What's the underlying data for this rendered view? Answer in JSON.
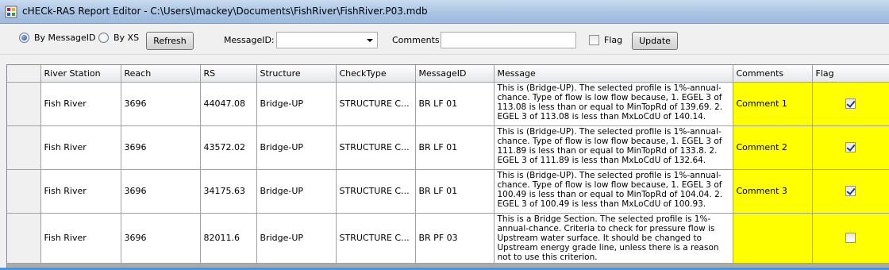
{
  "window": {
    "title": "cHECk-RAS Report Editor - C:\\Users\\lmackey\\Documents\\FishRiver\\FishRiver.P03.mdb"
  },
  "toolbar": {
    "by_messageid_label": "By MessageID",
    "by_xs_label": "By XS",
    "selected_mode": "By MessageID",
    "refresh_label": "Refresh",
    "messageid_label": "MessageID:",
    "messageid_value": "",
    "comments_label": "Comments:",
    "comments_value": "",
    "flag_label": "Flag",
    "flag_checked": false,
    "update_label": "Update"
  },
  "grid": {
    "columns": [
      "River Station",
      "Reach",
      "RS",
      "Structure",
      "CheckType",
      "MessageID",
      "Message",
      "Comments",
      "Flag"
    ],
    "rows": [
      {
        "river": "Fish River",
        "reach": "3696",
        "rs": "44047.08",
        "structure": "Bridge-UP",
        "checktype": "STRUCTURE C...",
        "messageid": "BR LF 01",
        "message": "This is (Bridge-UP). The selected profile is 1%-annual-chance. Type of flow is low flow because, 1. EGEL 3 of 113.08 is less than or equal to MinTopRd of 139.69. 2.  EGEL 3 of 113.08 is less than MxLoCdU of 140.14.",
        "comments": "Comment 1",
        "flag": true
      },
      {
        "river": "Fish River",
        "reach": "3696",
        "rs": "43572.02",
        "structure": "Bridge-UP",
        "checktype": "STRUCTURE C...",
        "messageid": "BR LF 01",
        "message": "This is (Bridge-UP). The selected profile is 1%-annual-chance. Type of flow is low flow because, 1. EGEL 3 of 111.89 is less than or equal to MinTopRd of 133.8. 2.  EGEL 3 of 111.89 is less than MxLoCdU of 132.64.",
        "comments": "Comment 2",
        "flag": true
      },
      {
        "river": "Fish River",
        "reach": "3696",
        "rs": "34175.63",
        "structure": "Bridge-UP",
        "checktype": "STRUCTURE C...",
        "messageid": "BR LF 01",
        "message": "This is (Bridge-UP). The selected profile is 1%-annual-chance. Type of flow is low flow because, 1. EGEL 3 of 100.49 is less than or equal to MinTopRd of 104.04. 2.  EGEL 3 of 100.49 is less than MxLoCdU of 100.93.",
        "comments": "Comment 3",
        "flag": true
      },
      {
        "river": "Fish River",
        "reach": "3696",
        "rs": "82011.6",
        "structure": "Bridge-UP",
        "checktype": "STRUCTURE C...",
        "messageid": "BR PF 03",
        "message": "This is a Bridge Section. The selected profile is 1%-annual-chance. Criteria to check for pressure flow is Upstream water surface. It should be changed to Upstream energy grade line, unless there is a reason not to use this criterion.",
        "comments": "",
        "flag": false
      }
    ]
  },
  "colors": {
    "comments_highlight": "#ffff00",
    "flag_highlight": "#ffff00",
    "selection_accent": "#3399ff"
  }
}
